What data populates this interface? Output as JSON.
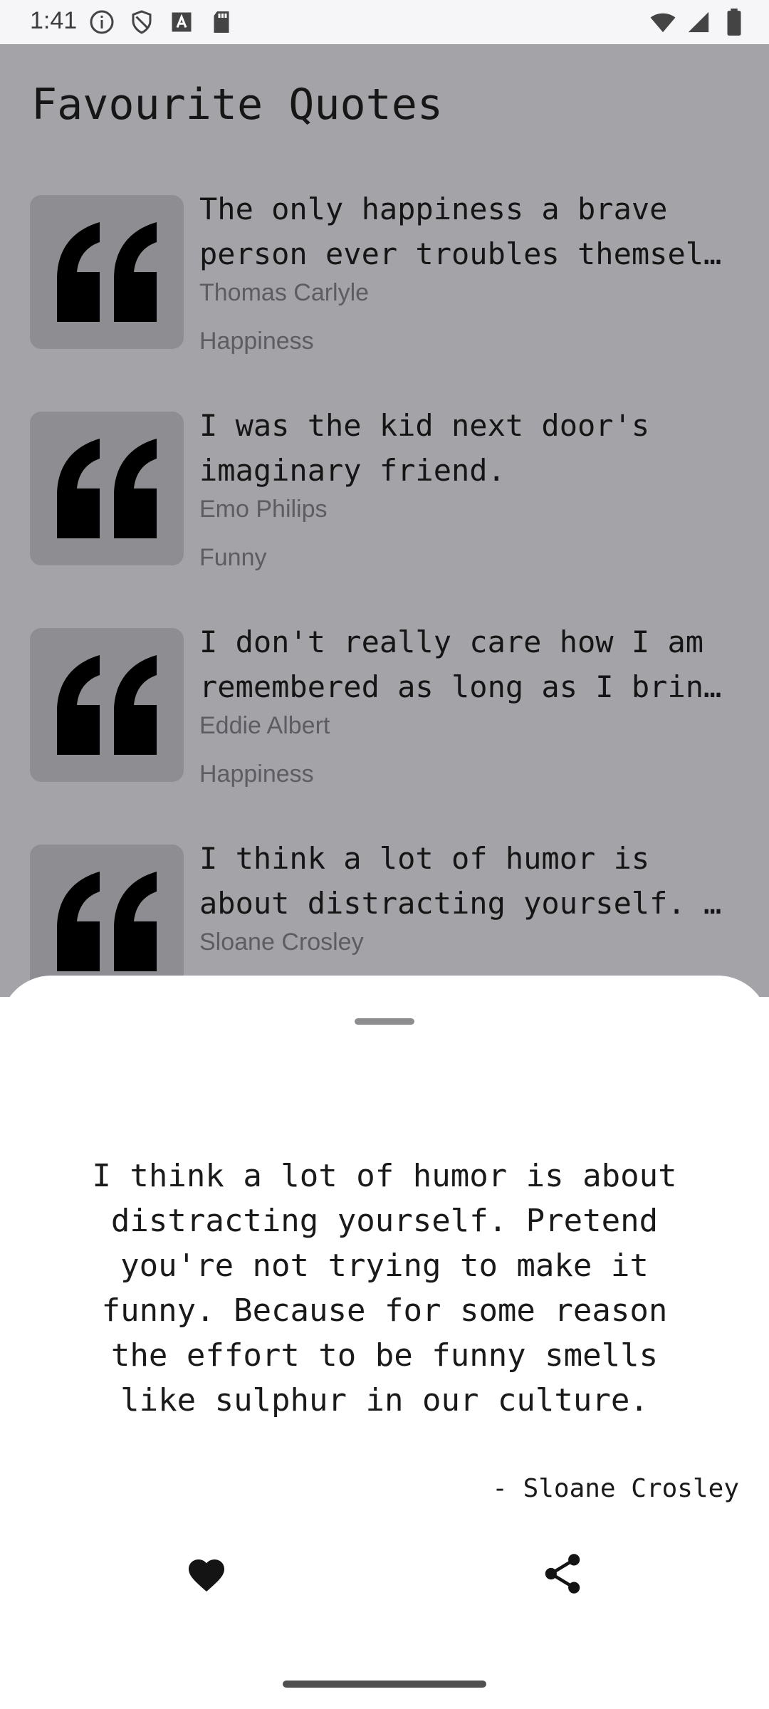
{
  "status_bar": {
    "time": "1:41",
    "left_icons": [
      "info-icon",
      "shield-icon",
      "text-a-icon",
      "sd-card-icon"
    ],
    "right_icons": [
      "wifi-icon",
      "signal-icon",
      "battery-icon"
    ]
  },
  "page": {
    "title": "Favourite Quotes"
  },
  "quotes": [
    {
      "text": "The only happiness a brave\nperson ever troubles themsel…",
      "author": "Thomas Carlyle",
      "tag": "Happiness"
    },
    {
      "text": "I was the kid next door's\nimaginary friend.",
      "author": "Emo Philips",
      "tag": "Funny"
    },
    {
      "text": "I don't really care how I am\nremembered as long as I brin…",
      "author": "Eddie Albert",
      "tag": "Happiness"
    },
    {
      "text": "I think a lot of humor is\nabout distracting yourself. …",
      "author": "Sloane Crosley",
      "tag": ""
    }
  ],
  "sheet": {
    "quote": "I think a lot of humor is about distracting yourself. Pretend you're not trying to make it funny. Because for some reason the effort to be funny smells like sulphur in our culture.",
    "author": "- Sloane Crosley",
    "actions": [
      "heart-icon",
      "share-icon"
    ]
  },
  "colors": {
    "scrim_bg": "#a4a3a8",
    "thumb_bg": "#8e8e92",
    "sheet_bg": "#ffffff",
    "text_dark": "#151515",
    "text_secondary": "#5d5c62"
  }
}
